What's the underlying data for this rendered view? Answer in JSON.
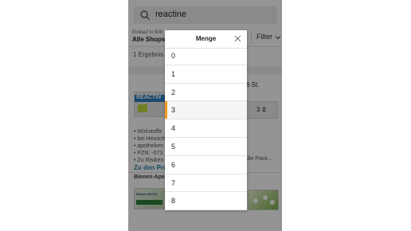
{
  "search": {
    "query": "reactine"
  },
  "shop_filter": {
    "small_label": "Einkauf in 808",
    "main_label": "Alle Shops",
    "filter_label": "Filter"
  },
  "results": {
    "count_text": "1 Ergebnis"
  },
  "product": {
    "brand_text": "REACTIN",
    "pack_size": "6 St.",
    "quantity_value": "3",
    "info_lines": [
      "• Wirkstoffe",
      "• bei Heusch",
      "• apotheken",
      "• PZN: -073",
      "• Zu Risiken"
    ],
    "info_right": "die Pack...",
    "details_link": "Zu den Pro",
    "shop_name": "Bienen-Ape"
  },
  "thumbnail": {
    "label": "Bienen AKTIV"
  },
  "modal": {
    "title": "Menge",
    "options": [
      "0",
      "1",
      "2",
      "3",
      "4",
      "5",
      "6",
      "7",
      "8"
    ],
    "selected": "3"
  },
  "colors": {
    "accent": "#f29b1e",
    "link": "#2a7ea8",
    "brand_blue": "#2b7fc0"
  },
  "icons": {
    "search": "search-icon",
    "close": "close-icon",
    "filter_chevron": "chevron-down-icon",
    "quantity": "updown-arrows-icon"
  }
}
